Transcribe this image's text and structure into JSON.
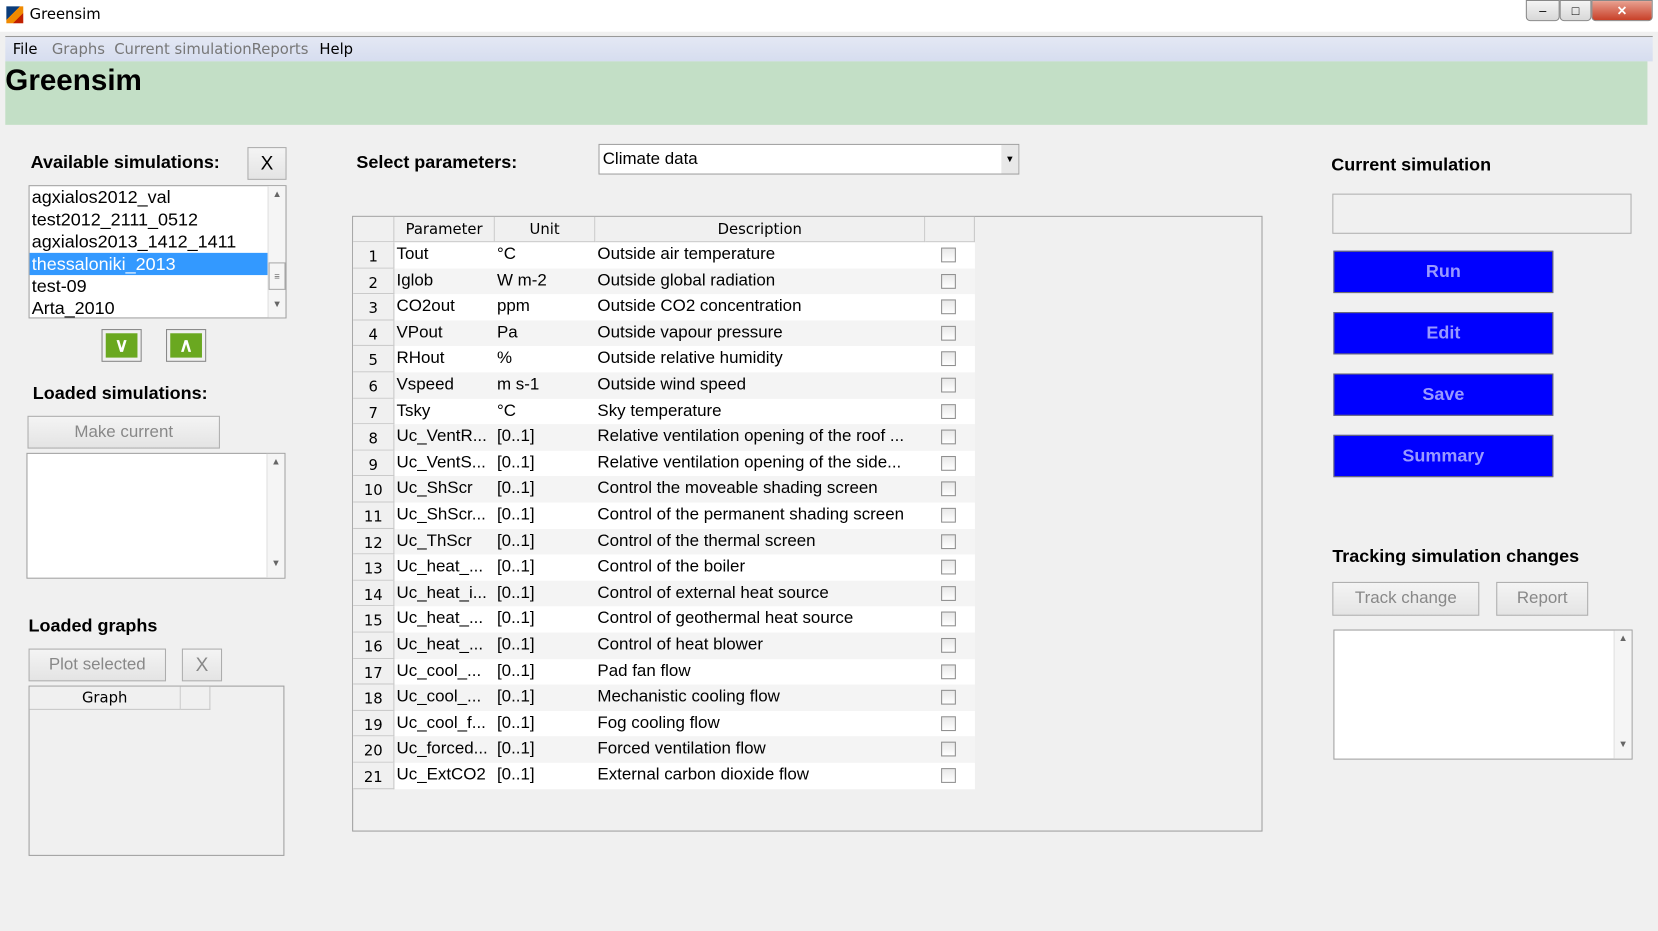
{
  "window": {
    "title": "Greensim"
  },
  "menu": [
    "File",
    "Graphs",
    "Current simulation",
    "Reports",
    "Help"
  ],
  "header": {
    "title": "Greensim"
  },
  "available": {
    "label": "Available simulations:",
    "clear_label": "X",
    "items": [
      "agxialos2012_val",
      "test2012_2111_0512",
      "agxialos2013_1412_1411",
      "thessaloniki_2013",
      "test-09",
      "Arta_2010"
    ],
    "selected": "thessaloniki_2013"
  },
  "loaded": {
    "label": "Loaded simulations:",
    "make_current": "Make current"
  },
  "graphs": {
    "label": "Loaded graphs",
    "plot_selected": "Plot selected",
    "clear_label": "X",
    "column": "Graph"
  },
  "params": {
    "label": "Select parameters:",
    "selected": "Climate data",
    "columns": [
      "Parameter",
      "Unit",
      "Description"
    ],
    "rows": [
      [
        "Tout",
        "°C",
        "Outside air temperature"
      ],
      [
        "Iglob",
        "W m-2",
        "Outside global radiation"
      ],
      [
        "CO2out",
        "ppm",
        "Outside CO2 concentration"
      ],
      [
        "VPout",
        "Pa",
        "Outside vapour pressure"
      ],
      [
        "RHout",
        "%",
        "Outside relative humidity"
      ],
      [
        "Vspeed",
        "m s-1",
        "Outside wind speed"
      ],
      [
        "Tsky",
        "°C",
        "Sky temperature"
      ],
      [
        "Uc_VentR...",
        "[0..1]",
        "Relative ventilation opening of the roof ..."
      ],
      [
        "Uc_VentS...",
        "[0..1]",
        "Relative ventilation opening of the side..."
      ],
      [
        "Uc_ShScr",
        "[0..1]",
        "Control the moveable shading screen"
      ],
      [
        "Uc_ShScr...",
        "[0..1]",
        "Control of the permanent shading screen"
      ],
      [
        "Uc_ThScr",
        "[0..1]",
        "Control of the thermal screen"
      ],
      [
        "Uc_heat_...",
        "[0..1]",
        "Control of the boiler"
      ],
      [
        "Uc_heat_i...",
        "[0..1]",
        "Control of external heat source"
      ],
      [
        "Uc_heat_...",
        "[0..1]",
        "Control of geothermal heat source"
      ],
      [
        "Uc_heat_...",
        "[0..1]",
        "Control of heat blower"
      ],
      [
        "Uc_cool_...",
        "[0..1]",
        "Pad fan flow"
      ],
      [
        "Uc_cool_...",
        "[0..1]",
        "Mechanistic cooling flow"
      ],
      [
        "Uc_cool_f...",
        "[0..1]",
        "Fog cooling flow"
      ],
      [
        "Uc_forced...",
        "[0..1]",
        "Forced ventilation flow"
      ],
      [
        "Uc_ExtCO2",
        "[0..1]",
        "External carbon dioxide flow"
      ]
    ]
  },
  "current": {
    "label": "Current simulation",
    "name": "",
    "run": "Run",
    "edit": "Edit",
    "save": "Save",
    "summary": "Summary"
  },
  "tracking": {
    "label": "Tracking simulation changes",
    "track": "Track change",
    "report": "Report"
  }
}
